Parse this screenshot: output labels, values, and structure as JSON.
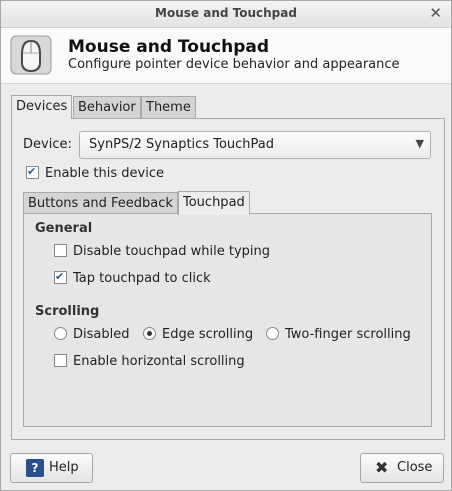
{
  "window": {
    "title": "Mouse and Touchpad",
    "close_glyph": "✕"
  },
  "header": {
    "title": "Mouse and Touchpad",
    "subtitle": "Configure pointer device behavior and appearance"
  },
  "tabs": [
    {
      "label": "Devices",
      "active": true
    },
    {
      "label": "Behavior",
      "active": false
    },
    {
      "label": "Theme",
      "active": false
    }
  ],
  "device": {
    "label": "Device:",
    "selected": "SynPS/2 Synaptics TouchPad"
  },
  "enable_device": {
    "label": "Enable this device",
    "checked": true
  },
  "subtabs": [
    {
      "label": "Buttons and Feedback",
      "active": false
    },
    {
      "label": "Touchpad",
      "active": true
    }
  ],
  "touchpad": {
    "general_title": "General",
    "disable_while_typing": {
      "label": "Disable touchpad while typing",
      "checked": false
    },
    "tap_to_click": {
      "label": "Tap touchpad to click",
      "checked": true
    },
    "scrolling_title": "Scrolling",
    "scroll_options": [
      {
        "label": "Disabled",
        "checked": false
      },
      {
        "label": "Edge scrolling",
        "checked": true
      },
      {
        "label": "Two-finger scrolling",
        "checked": false
      }
    ],
    "horizontal_scrolling": {
      "label": "Enable horizontal scrolling",
      "checked": false
    }
  },
  "buttons": {
    "help": "Help",
    "close": "Close",
    "help_glyph": "?",
    "close_glyph": "✖"
  }
}
